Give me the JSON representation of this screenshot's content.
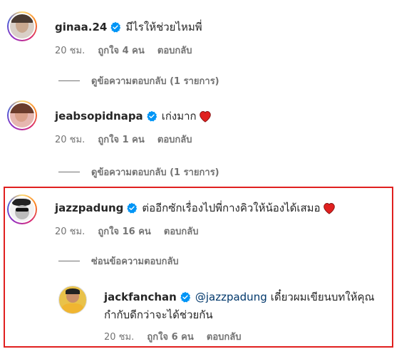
{
  "comments": [
    {
      "username": "ginaa.24",
      "text": "มีไรให้ช่วยไหมพี่",
      "time": "20 ชม.",
      "likes": "ถูกใจ 4 คน",
      "reply_label": "ตอบกลับ",
      "view_replies": "ดูข้อความตอบกลับ (1 รายการ)"
    },
    {
      "username": "jeabsopidnapa",
      "text": "เก่งมาก",
      "time": "20 ชม.",
      "likes": "ถูกใจ 1 คน",
      "reply_label": "ตอบกลับ",
      "view_replies": "ดูข้อความตอบกลับ (1 รายการ)"
    },
    {
      "username": "jazzpadung",
      "text": "ต่ออีกซักเรื่องไปพี่กางคิวให้น้องได้เสมอ",
      "time": "20 ชม.",
      "likes": "ถูกใจ 16 คน",
      "reply_label": "ตอบกลับ",
      "hide_replies": "ซ่อนข้อความตอบกลับ"
    }
  ],
  "reply": {
    "username": "jackfanchan",
    "mention": "@jazzpadung",
    "text_line1": "เดี๋ยวผมเขียนบทให้คุณ",
    "text_line2": "กำกับดีกว่าจะได้ช่วยกัน",
    "time": "20 ชม.",
    "likes": "ถูกใจ 6 คน",
    "reply_label": "ตอบกลับ"
  },
  "colors": {
    "verified": "#0095f6",
    "heart": "#e0201f",
    "highlight_border": "#e0201f",
    "mention": "#00376b"
  },
  "icons": [
    "verified-badge-icon",
    "heart-icon"
  ]
}
